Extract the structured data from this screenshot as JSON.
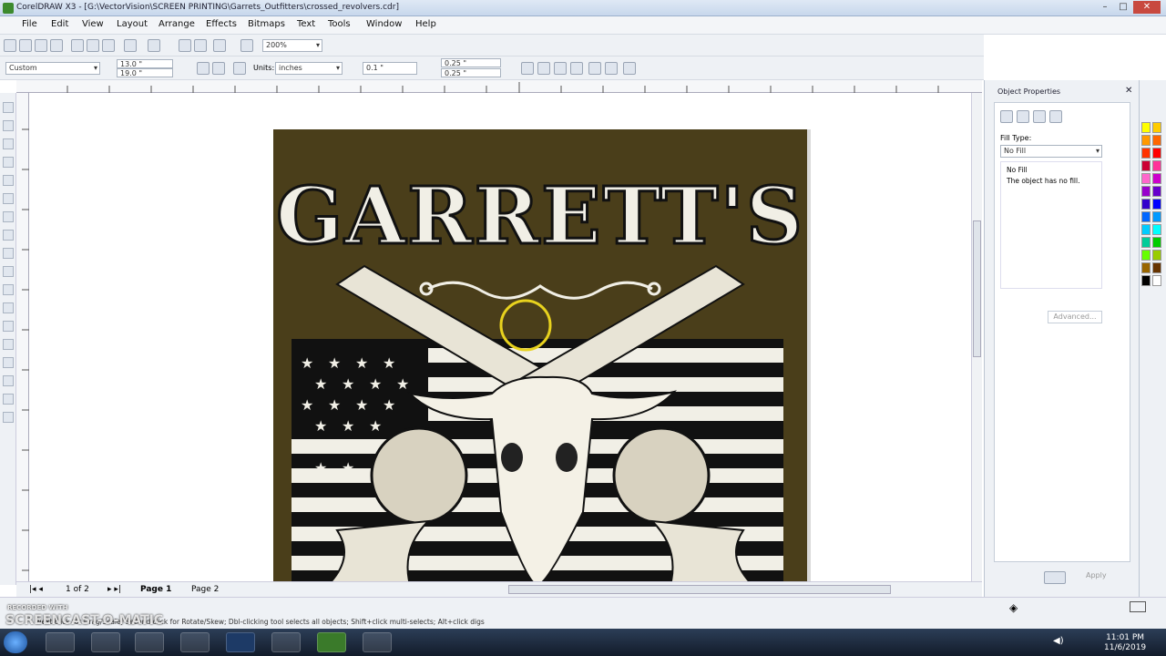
{
  "window": {
    "title": "CorelDRAW X3 - [G:\\VectorVision\\SCREEN PRINTING\\Garrets_Outfitters\\crossed_revolvers.cdr]",
    "minimize": "–",
    "maximize": "□",
    "close": "✕"
  },
  "menu": [
    "File",
    "Edit",
    "View",
    "Layout",
    "Arrange",
    "Effects",
    "Bitmaps",
    "Text",
    "Tools",
    "Window",
    "Help"
  ],
  "toolbar": {
    "zoom": "200%",
    "page_size": "Custom",
    "width": "13.0 \"",
    "height": "19.0 \"",
    "units_label": "Units:",
    "units": "inches",
    "nudge": "0.1 \"",
    "dup_x": "0.25 \"",
    "dup_y": "0.25 \""
  },
  "artwork": {
    "headline": "GARRETT'S",
    "background_color": "#4a3e1a"
  },
  "page_nav": {
    "count": "1 of 2",
    "page1": "Page 1",
    "page2": "Page 2"
  },
  "status": {
    "hint": "Next click for Drag/Scale; Second click for Rotate/Skew; Dbl-clicking tool selects all objects; Shift+click multi-selects; Alt+click digs",
    "watermark_small": "RECORDED WITH",
    "watermark": "SCREENCAST-O-MATIC"
  },
  "docker": {
    "title": "Object Properties",
    "fill_type_label": "Fill Type:",
    "fill_type": "No Fill",
    "fill_name": "No Fill",
    "fill_desc": "The object has no fill.",
    "advanced": "Advanced...",
    "apply": "Apply"
  },
  "palette": [
    "#ffff00",
    "#ffcc00",
    "#ff9900",
    "#ff6600",
    "#ff3300",
    "#ff0000",
    "#cc0033",
    "#ff3399",
    "#ff66cc",
    "#cc00cc",
    "#9900cc",
    "#6600cc",
    "#3300cc",
    "#0000ff",
    "#0066ff",
    "#0099ff",
    "#00ccff",
    "#00ffff",
    "#00cc99",
    "#00cc00",
    "#66ff00",
    "#99cc00",
    "#996600",
    "#663300",
    "#000000",
    "#ffffff"
  ],
  "clock": {
    "time": "11:01 PM",
    "date": "11/6/2019"
  }
}
